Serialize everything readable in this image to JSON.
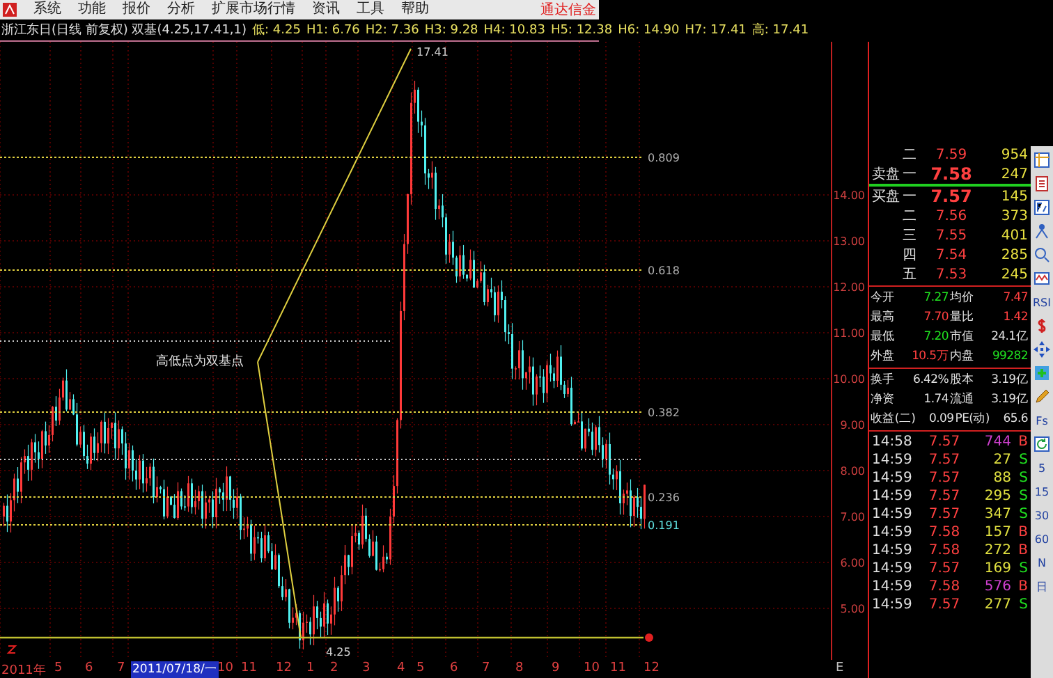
{
  "menu_bar": {
    "items": [
      "系统",
      "功能",
      "报价",
      "分析",
      "扩展市场行情",
      "资讯",
      "工具",
      "帮助"
    ],
    "brand": "通达信金"
  },
  "info_bar": {
    "title": "浙江东日(日线 前复权) 双基(4.25,17.41,1)",
    "values": [
      "低: 4.25",
      "H1: 6.76",
      "H2: 7.36",
      "H3: 9.28",
      "H4: 10.83",
      "H5: 12.38",
      "H6: 14.90",
      "H7: 17.41",
      "高: 17.41"
    ]
  },
  "chart": {
    "price_axis": [
      "14.00",
      "13.00",
      "12.00",
      "11.00",
      "10.00",
      "9.00",
      "8.00",
      "7.00",
      "6.00",
      "5.00"
    ],
    "levels": [
      "0.809",
      "0.618",
      "0.382",
      "0.236",
      "0.191"
    ],
    "note": "高低点为双基点",
    "high_label": "17.41",
    "low_label": "4.25"
  },
  "date_axis": {
    "labels": [
      {
        "text": "2011年",
        "selected": false
      },
      {
        "text": "5",
        "selected": false
      },
      {
        "text": "6",
        "selected": false
      },
      {
        "text": "7",
        "selected": false
      },
      {
        "text": "2011/07/18/一",
        "selected": true
      },
      {
        "text": "10",
        "selected": false
      },
      {
        "text": "11",
        "selected": false
      },
      {
        "text": "12",
        "selected": false
      },
      {
        "text": "1",
        "selected": false
      },
      {
        "text": "2",
        "selected": false
      },
      {
        "text": "3",
        "selected": false
      },
      {
        "text": "4",
        "selected": false
      },
      {
        "text": "5",
        "selected": false
      },
      {
        "text": "6",
        "selected": false
      },
      {
        "text": "7",
        "selected": false
      },
      {
        "text": "8",
        "selected": false
      },
      {
        "text": "9",
        "selected": false
      },
      {
        "text": "10",
        "selected": false
      },
      {
        "text": "11",
        "selected": false
      },
      {
        "text": "12",
        "selected": false
      }
    ],
    "corner": "E"
  },
  "order_book": {
    "sell": [
      {
        "level": "二",
        "price": "7.59",
        "volume": "954"
      },
      {
        "side": "卖盘",
        "level": "一",
        "price": "7.58",
        "volume": "247"
      }
    ],
    "buy": [
      {
        "side": "买盘",
        "level": "一",
        "price": "7.57",
        "volume": "145"
      },
      {
        "level": "二",
        "price": "7.56",
        "volume": "373"
      },
      {
        "level": "三",
        "price": "7.55",
        "volume": "401"
      },
      {
        "level": "四",
        "price": "7.54",
        "volume": "285"
      },
      {
        "level": "五",
        "price": "7.53",
        "volume": "245"
      }
    ]
  },
  "stats": [
    [
      {
        "label": "今开",
        "value": "7.27",
        "color": "#20e020"
      },
      {
        "label": "均价",
        "value": "7.47",
        "color": "#ff4040"
      }
    ],
    [
      {
        "label": "最高",
        "value": "7.70",
        "color": "#ff4040"
      },
      {
        "label": "量比",
        "value": "1.42",
        "color": "#ff4040"
      }
    ],
    [
      {
        "label": "最低",
        "value": "7.20",
        "color": "#20e020"
      },
      {
        "label": "市值",
        "value": "24.1亿",
        "color": "#e0e0e0"
      }
    ],
    [
      {
        "label": "外盘",
        "value": "10.5万",
        "color": "#ff4040"
      },
      {
        "label": "内盘",
        "value": "99282",
        "color": "#20e020"
      }
    ]
  ],
  "stats2": [
    [
      {
        "label": "换手",
        "value": "6.42%",
        "color": "#e0e0e0"
      },
      {
        "label": "股本",
        "value": "3.19亿",
        "color": "#e0e0e0"
      }
    ],
    [
      {
        "label": "净资",
        "value": "1.74",
        "color": "#e0e0e0"
      },
      {
        "label": "流通",
        "value": "3.19亿",
        "color": "#e0e0e0"
      }
    ],
    [
      {
        "label": "收益(二)",
        "value": "0.09",
        "color": "#e0e0e0"
      },
      {
        "label": "PE(动)",
        "value": "65.6",
        "color": "#e0e0e0"
      }
    ]
  ],
  "ticks": [
    {
      "time": "14:58",
      "price": {
        "text": "7.57",
        "color": "#ff4040"
      },
      "volume": {
        "text": "744",
        "color": "#d040d0"
      },
      "side": {
        "text": "B",
        "color": "#ff4040"
      }
    },
    {
      "time": "14:59",
      "price": {
        "text": "7.57",
        "color": "#ff4040"
      },
      "volume": {
        "text": "27",
        "color": "#e0e040"
      },
      "side": {
        "text": "S",
        "color": "#20e020"
      }
    },
    {
      "time": "14:59",
      "price": {
        "text": "7.57",
        "color": "#ff4040"
      },
      "volume": {
        "text": "88",
        "color": "#e0e040"
      },
      "side": {
        "text": "S",
        "color": "#20e020"
      }
    },
    {
      "time": "14:59",
      "price": {
        "text": "7.57",
        "color": "#ff4040"
      },
      "volume": {
        "text": "295",
        "color": "#e0e040"
      },
      "side": {
        "text": "S",
        "color": "#20e020"
      }
    },
    {
      "time": "14:59",
      "price": {
        "text": "7.57",
        "color": "#ff4040"
      },
      "volume": {
        "text": "347",
        "color": "#e0e040"
      },
      "side": {
        "text": "S",
        "color": "#20e020"
      }
    },
    {
      "time": "14:59",
      "price": {
        "text": "7.58",
        "color": "#ff4040"
      },
      "volume": {
        "text": "157",
        "color": "#e0e040"
      },
      "side": {
        "text": "B",
        "color": "#ff4040"
      }
    },
    {
      "time": "14:59",
      "price": {
        "text": "7.58",
        "color": "#ff4040"
      },
      "volume": {
        "text": "272",
        "color": "#e0e040"
      },
      "side": {
        "text": "B",
        "color": "#ff4040"
      }
    },
    {
      "time": "14:59",
      "price": {
        "text": "7.57",
        "color": "#ff4040"
      },
      "volume": {
        "text": "169",
        "color": "#e0e040"
      },
      "side": {
        "text": "S",
        "color": "#20e020"
      }
    },
    {
      "time": "14:59",
      "price": {
        "text": "7.58",
        "color": "#ff4040"
      },
      "volume": {
        "text": "576",
        "color": "#d040d0"
      },
      "side": {
        "text": "B",
        "color": "#ff4040"
      }
    },
    {
      "time": "14:59",
      "price": {
        "text": "7.57",
        "color": "#ff4040"
      },
      "volume": {
        "text": "277",
        "color": "#e0e040"
      },
      "side": {
        "text": "S",
        "color": "#20e020"
      }
    }
  ],
  "toolbar": [
    {
      "kind": "icon"
    },
    {
      "kind": "icon"
    },
    {
      "kind": "icon"
    },
    {
      "kind": "icon"
    },
    {
      "kind": "icon"
    },
    {
      "kind": "icon"
    },
    {
      "kind": "text",
      "label": "RSI"
    },
    {
      "kind": "icon"
    },
    {
      "kind": "icon"
    },
    {
      "kind": "icon"
    },
    {
      "kind": "icon"
    },
    {
      "kind": "text",
      "label": "Fs"
    },
    {
      "kind": "icon"
    },
    {
      "kind": "text",
      "label": "5"
    },
    {
      "kind": "text",
      "label": "15"
    },
    {
      "kind": "text",
      "label": "30"
    },
    {
      "kind": "text",
      "label": "60"
    },
    {
      "kind": "text",
      "label": "N"
    },
    {
      "kind": "text",
      "label": "日"
    }
  ]
}
